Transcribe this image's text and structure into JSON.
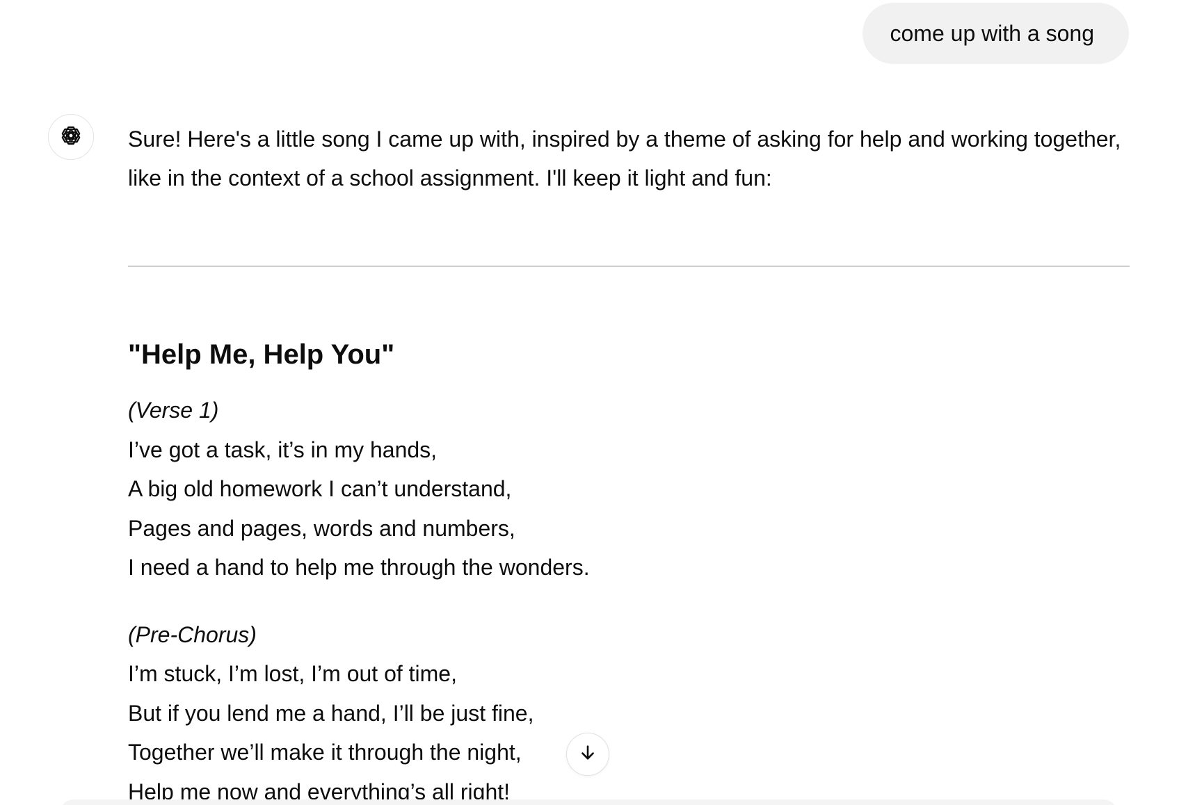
{
  "user_message": {
    "text": "come up with a song"
  },
  "assistant": {
    "avatar_icon": "openai-logo-icon",
    "intro": "Sure! Here's a little song I came up with, inspired by a theme of asking for help and working together, like in the context of a school assignment. I'll keep it light and fun:",
    "song_title": "\"Help Me, Help You\"",
    "verse1": {
      "label": "(Verse 1)",
      "lines": [
        "I’ve got a task, it’s in my hands,",
        "A big old homework I can’t understand,",
        "Pages and pages, words and numbers,",
        "I need a hand to help me through the wonders."
      ]
    },
    "prechorus": {
      "label": "(Pre-Chorus)",
      "lines": [
        "I’m stuck, I’m lost, I’m out of time,",
        "But if you lend me a hand, I’ll be just fine,",
        "Together we’ll make it through the night,",
        "Help me now and everything’s all right!"
      ]
    }
  },
  "scroll_button": {
    "icon": "arrow-down-icon"
  },
  "colors": {
    "user_bubble_bg": "#f1f1f1",
    "divider": "#cfcfcf",
    "text": "#0d0d0d"
  }
}
